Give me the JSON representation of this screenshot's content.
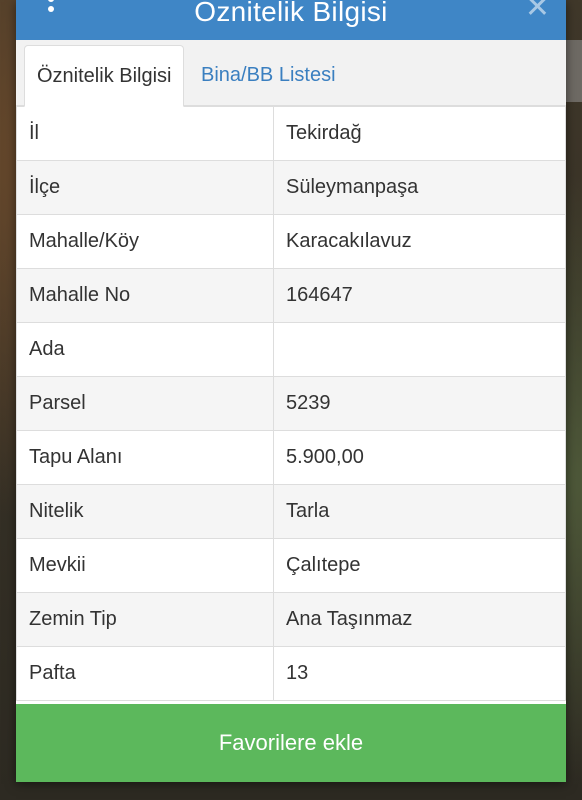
{
  "dialog": {
    "title": "Öznitelik Bilgisi",
    "close_icon": "close-icon",
    "menu_icon": "kebab-menu-icon"
  },
  "tabs": [
    {
      "label": "Öznitelik Bilgisi",
      "active": true
    },
    {
      "label": "Bina/BB Listesi",
      "active": false
    }
  ],
  "rows": [
    {
      "label": "İl",
      "value": "Tekirdağ"
    },
    {
      "label": "İlçe",
      "value": "Süleymanpaşa"
    },
    {
      "label": "Mahalle/Köy",
      "value": "Karacakılavuz"
    },
    {
      "label": "Mahalle No",
      "value": "164647"
    },
    {
      "label": "Ada",
      "value": ""
    },
    {
      "label": "Parsel",
      "value": "5239"
    },
    {
      "label": "Tapu Alanı",
      "value": "5.900,00"
    },
    {
      "label": "Nitelik",
      "value": "Tarla"
    },
    {
      "label": "Mevkii",
      "value": "Çalıtepe"
    },
    {
      "label": "Zemin Tip",
      "value": "Ana Taşınmaz"
    },
    {
      "label": "Pafta",
      "value": "13"
    }
  ],
  "footer": {
    "button_label": "Favorilere ekle"
  },
  "colors": {
    "header": "#3f86c6",
    "tab_link": "#3a7fc0",
    "button": "#5cb85c"
  }
}
